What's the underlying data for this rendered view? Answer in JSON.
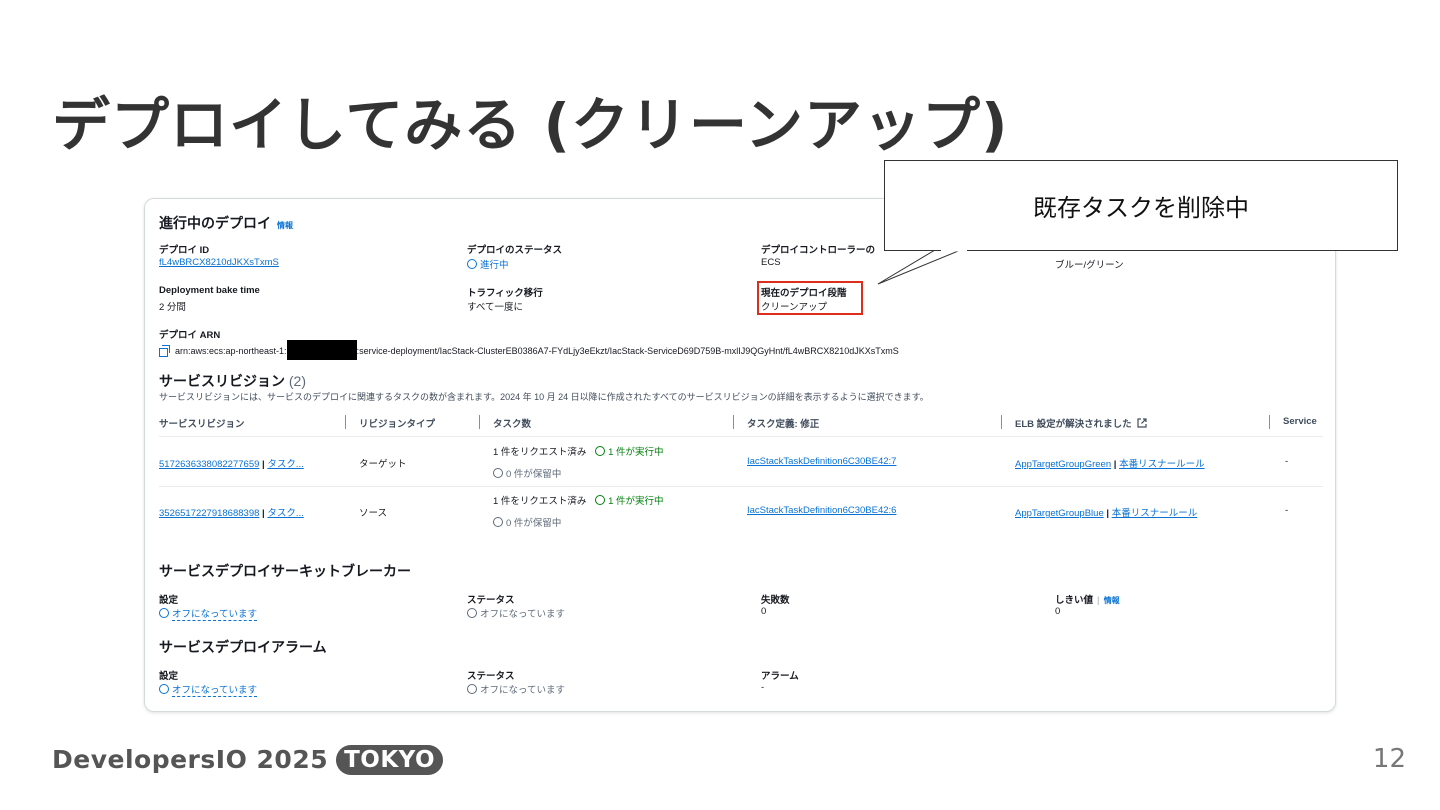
{
  "slide": {
    "title": "デプロイしてみる (クリーンアップ)",
    "callout": "既存タスクを削除中",
    "footer_brand": "DevelopersIO 2025",
    "footer_badge": "TOKYO",
    "page_number": "12"
  },
  "deploy": {
    "heading": "進行中のデプロイ",
    "info": "情報",
    "id_label": "デプロイ ID",
    "id_value": "fL4wBRCX8210dJKXsTxmS",
    "status_label": "デプロイのステータス",
    "status_value": "進行中",
    "controller_label": "デプロイコントローラーの",
    "controller_value": "ECS",
    "strategy_value": "ブルー/グリーン",
    "bake_label": "Deployment bake time",
    "bake_value": "2 分間",
    "traffic_label": "トラフィック移行",
    "traffic_value": "すべて一度に",
    "phase_label": "現在のデプロイ段階",
    "phase_value": "クリーンアップ",
    "arn_label": "デプロイ ARN",
    "arn_prefix": "arn:aws:ecs:ap-northeast-1:",
    "arn_suffix": ":service-deployment/IacStack-ClusterEB0386A7-FYdLjy3eEkzt/IacStack-ServiceD69D759B-mxlIJ9QGyHnt/fL4wBRCX8210dJKXsTxmS"
  },
  "revisions": {
    "heading": "サービスリビジョン",
    "count": "(2)",
    "description": "サービスリビジョンには、サービスのデプロイに関連するタスクの数が含まれます。2024 年 10 月 24 日以降に作成されたすべてのサービスリビジョンの詳細を表示するように選択できます。",
    "columns": [
      "サービスリビジョン",
      "リビジョンタイプ",
      "タスク数",
      "タスク定義: 修正",
      "ELB 設定が解決されました",
      "Service"
    ],
    "rows": [
      {
        "revision": "5172636338082277659",
        "task_link": "タスク...",
        "type": "ターゲット",
        "requested": "1 件をリクエスト済み",
        "running": "1 件が実行中",
        "pending": "0 件が保留中",
        "task_def": "IacStackTaskDefinition6C30BE42:7",
        "tg": "AppTargetGroupGreen",
        "rule": "本番リスナールール",
        "service": "-"
      },
      {
        "revision": "3526517227918688398",
        "task_link": "タスク...",
        "type": "ソース",
        "requested": "1 件をリクエスト済み",
        "running": "1 件が実行中",
        "pending": "0 件が保留中",
        "task_def": "IacStackTaskDefinition6C30BE42:6",
        "tg": "AppTargetGroupBlue",
        "rule": "本番リスナールール",
        "service": "-"
      }
    ]
  },
  "breaker": {
    "heading": "サービスデプロイサーキットブレーカー",
    "setting_label": "設定",
    "setting_value": "オフになっています",
    "status_label": "ステータス",
    "status_value": "オフになっています",
    "failures_label": "失敗数",
    "failures_value": "0",
    "threshold_label": "しきい値",
    "threshold_info": "情報",
    "threshold_value": "0"
  },
  "alarm": {
    "heading": "サービスデプロイアラーム",
    "setting_label": "設定",
    "setting_value": "オフになっています",
    "status_label": "ステータス",
    "status_value": "オフになっています",
    "alarm_label": "アラーム",
    "alarm_value": "-"
  },
  "colors": {
    "link": "#0972d3",
    "success": "#037f0c",
    "highlight": "#e02d1b"
  }
}
